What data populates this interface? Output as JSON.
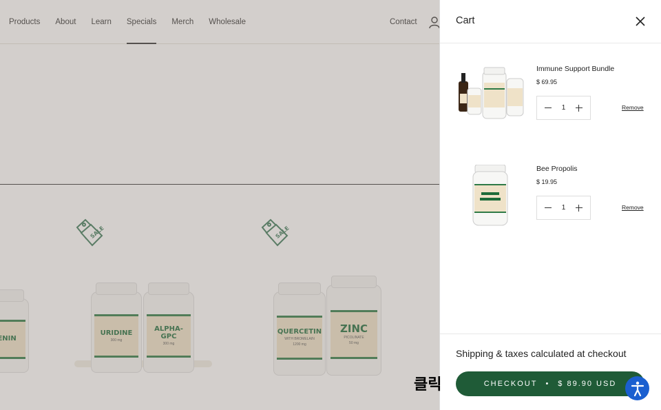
{
  "nav": {
    "links": [
      "Products",
      "About",
      "Learn",
      "Specials",
      "Merch",
      "Wholesale"
    ],
    "active_index": 3,
    "contact": "Contact",
    "user_icon": "user-icon"
  },
  "background_products": [
    {
      "sale_badge": "SALE",
      "bottles": [
        {
          "name": "GENIN"
        }
      ]
    },
    {
      "sale_badge": "SALE",
      "bottles": [
        {
          "name": "URIDINE",
          "dose": "300 mg"
        },
        {
          "name": "ALPHA-GPC",
          "dose": "300 mg"
        }
      ]
    },
    {
      "sale_badge": "SALE",
      "bottles": [
        {
          "name": "QUERCETIN",
          "sub": "WITH BROMELAIN",
          "dose": "1200 mg"
        },
        {
          "name": "ZINC",
          "sub": "PICOLINATE",
          "dose": "50 mg"
        }
      ]
    }
  ],
  "cart": {
    "title": "Cart",
    "close_icon": "close-icon",
    "items": [
      {
        "name": "Immune Support Bundle",
        "price": "$ 69.95",
        "qty": "1",
        "remove": "Remove"
      },
      {
        "name": "Bee Propolis",
        "price": "$ 19.95",
        "qty": "1",
        "remove": "Remove"
      }
    ],
    "shipping_note": "Shipping & taxes calculated at checkout",
    "checkout": {
      "label": "CHECKOUT",
      "separator": "•",
      "total": "$ 89.90 USD"
    }
  },
  "accessibility_icon": "accessibility-icon",
  "annotation_label": "클릭",
  "colors": {
    "checkout_green": "#1f5b37",
    "accessibility_blue": "#1a5fd0",
    "label_green": "#1d6b3a"
  }
}
